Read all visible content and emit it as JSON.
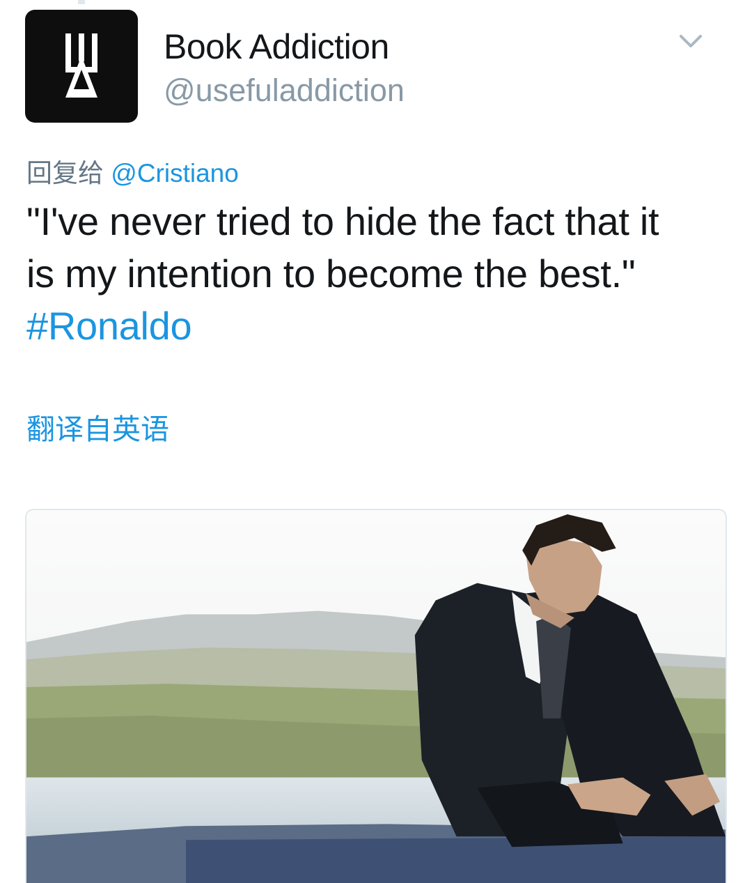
{
  "tweet": {
    "author": {
      "display_name": "Book Addiction",
      "handle": "@usefuladdiction",
      "avatar_icon": "book-addiction-logo-icon"
    },
    "menu_icon": "chevron-down-icon",
    "reply_to": {
      "prefix": "回复给",
      "mention": "@Cristiano"
    },
    "text_lines": [
      "\"I've never tried to hide the fact that it",
      "is my intention to become the best.\""
    ],
    "hashtag": "#Ronaldo",
    "translate_link": "翻译自英语"
  },
  "colors": {
    "link": "#1b95e0",
    "text": "#14171a",
    "secondary": "#8899a6",
    "avatar_bg": "#0e0e0e"
  }
}
